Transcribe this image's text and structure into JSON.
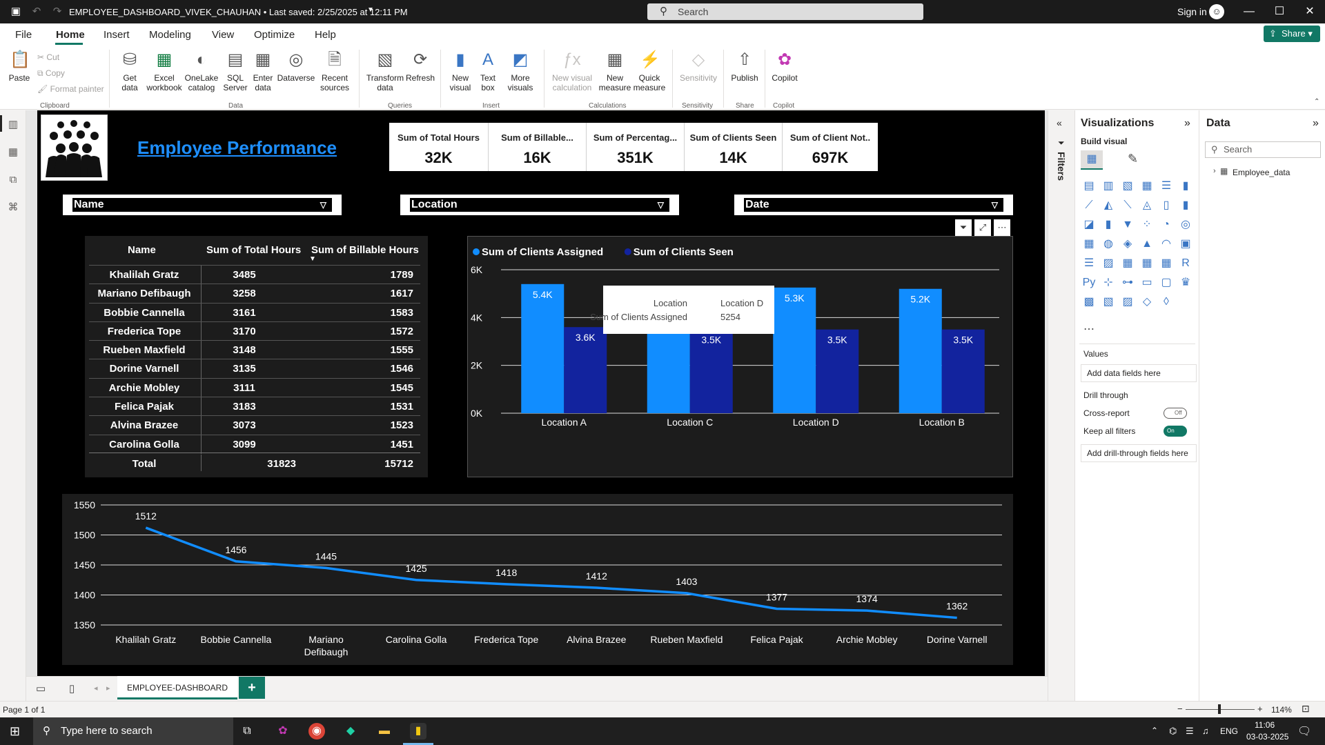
{
  "titlebar": {
    "title": "EMPLOYEE_DASHBOARD_VIVEK_CHAUHAN • Last saved: 2/25/2025 at 12:11 PM",
    "search_placeholder": "Search",
    "signin": "Sign in"
  },
  "menu": {
    "file": "File",
    "home": "Home",
    "insert": "Insert",
    "modeling": "Modeling",
    "view": "View",
    "optimize": "Optimize",
    "help": "Help",
    "share": "Share"
  },
  "ribbon": {
    "paste": "Paste",
    "cut": "Cut",
    "copy": "Copy",
    "format_painter": "Format painter",
    "clipboard": "Clipboard",
    "get_data": "Get data",
    "excel": "Excel workbook",
    "onelake": "OneLake catalog",
    "sql": "SQL Server",
    "enter_data": "Enter data",
    "dataverse": "Dataverse",
    "recent": "Recent sources",
    "data": "Data",
    "transform": "Transform data",
    "refresh": "Refresh",
    "queries": "Queries",
    "new_visual": "New visual",
    "text_box": "Text box",
    "more_visuals": "More visuals",
    "insert": "Insert",
    "new_visual_calc": "New visual calculation",
    "new_measure": "New measure",
    "quick_measure": "Quick measure",
    "calculations": "Calculations",
    "sensitivity": "Sensitivity",
    "sensitivity_grp": "Sensitivity",
    "publish": "Publish",
    "share_grp": "Share",
    "copilot": "Copilot",
    "copilot_grp": "Copilot"
  },
  "report": {
    "title": "Employee Performance",
    "kpis": [
      {
        "label": "Sum of Total Hours",
        "value": "32K"
      },
      {
        "label": "Sum of Billable...",
        "value": "16K"
      },
      {
        "label": "Sum of Percentag...",
        "value": "351K"
      },
      {
        "label": "Sum of Clients Seen",
        "value": "14K"
      },
      {
        "label": "Sum of Client Not..",
        "value": "697K"
      }
    ],
    "slicers": {
      "name": "Name",
      "location": "Location",
      "date": "Date"
    },
    "table": {
      "headers": [
        "Name",
        "Sum of Total Hours",
        "Sum of Billable Hours"
      ],
      "rows": [
        [
          "Khalilah Gratz",
          "3485",
          "1789"
        ],
        [
          "Mariano Defibaugh",
          "3258",
          "1617"
        ],
        [
          "Bobbie Cannella",
          "3161",
          "1583"
        ],
        [
          "Frederica Tope",
          "3170",
          "1572"
        ],
        [
          "Rueben Maxfield",
          "3148",
          "1555"
        ],
        [
          "Dorine Varnell",
          "3135",
          "1546"
        ],
        [
          "Archie Mobley",
          "3111",
          "1545"
        ],
        [
          "Felica Pajak",
          "3183",
          "1531"
        ],
        [
          "Alvina Brazee",
          "3073",
          "1523"
        ],
        [
          "Carolina Golla",
          "3099",
          "1451"
        ]
      ],
      "total": [
        "Total",
        "31823",
        "15712"
      ]
    },
    "tooltip": {
      "label1": "Location",
      "value1": "Location D",
      "label2": "Sum of Clients Assigned",
      "value2": "5254"
    }
  },
  "chart_data": [
    {
      "type": "bar",
      "categories": [
        "Location A",
        "Location C",
        "Location D",
        "Location B"
      ],
      "series": [
        {
          "name": "Sum of Clients Assigned",
          "values": [
            5.4,
            5.3,
            5.254,
            5.2
          ],
          "labels": [
            "5.4K",
            "5.3K",
            "5.3K",
            "5.2K"
          ],
          "color": "#118dff"
        },
        {
          "name": "Sum of Clients Seen",
          "values": [
            3.6,
            3.5,
            3.5,
            3.5
          ],
          "labels": [
            "3.6K",
            "3.5K",
            "3.5K",
            "3.5K"
          ],
          "color": "#12239e"
        }
      ],
      "yticks": [
        "0K",
        "2K",
        "4K",
        "6K"
      ],
      "ylim": [
        0,
        6
      ]
    },
    {
      "type": "line",
      "categories": [
        "Khalilah Gratz",
        "Bobbie Cannella",
        "Mariano Defibaugh",
        "Carolina Golla",
        "Frederica Tope",
        "Alvina Brazee",
        "Rueben Maxfield",
        "Felica Pajak",
        "Archie Mobley",
        "Dorine Varnell"
      ],
      "values": [
        1512,
        1456,
        1445,
        1425,
        1418,
        1412,
        1403,
        1377,
        1374,
        1362
      ],
      "yticks": [
        1350,
        1400,
        1450,
        1500,
        1550
      ],
      "ylim": [
        1350,
        1550
      ],
      "color": "#118dff"
    }
  ],
  "viz_pane": {
    "title": "Visualizations",
    "build": "Build visual",
    "values": "Values",
    "add_fields": "Add data fields here",
    "drill": "Drill through",
    "cross": "Cross-report",
    "cross_state": "Off",
    "keep": "Keep all filters",
    "keep_state": "On",
    "add_drill": "Add drill-through fields here"
  },
  "data_pane": {
    "title": "Data",
    "search": "Search",
    "table": "Employee_data"
  },
  "filters": {
    "label": "Filters"
  },
  "pages": {
    "tab": "EMPLOYEE-DASHBOARD"
  },
  "status": {
    "page": "Page 1 of 1",
    "zoom": "114%"
  },
  "taskbar": {
    "search": "Type here to search",
    "lang": "ENG",
    "time": "11:06",
    "date": "03-03-2025"
  }
}
